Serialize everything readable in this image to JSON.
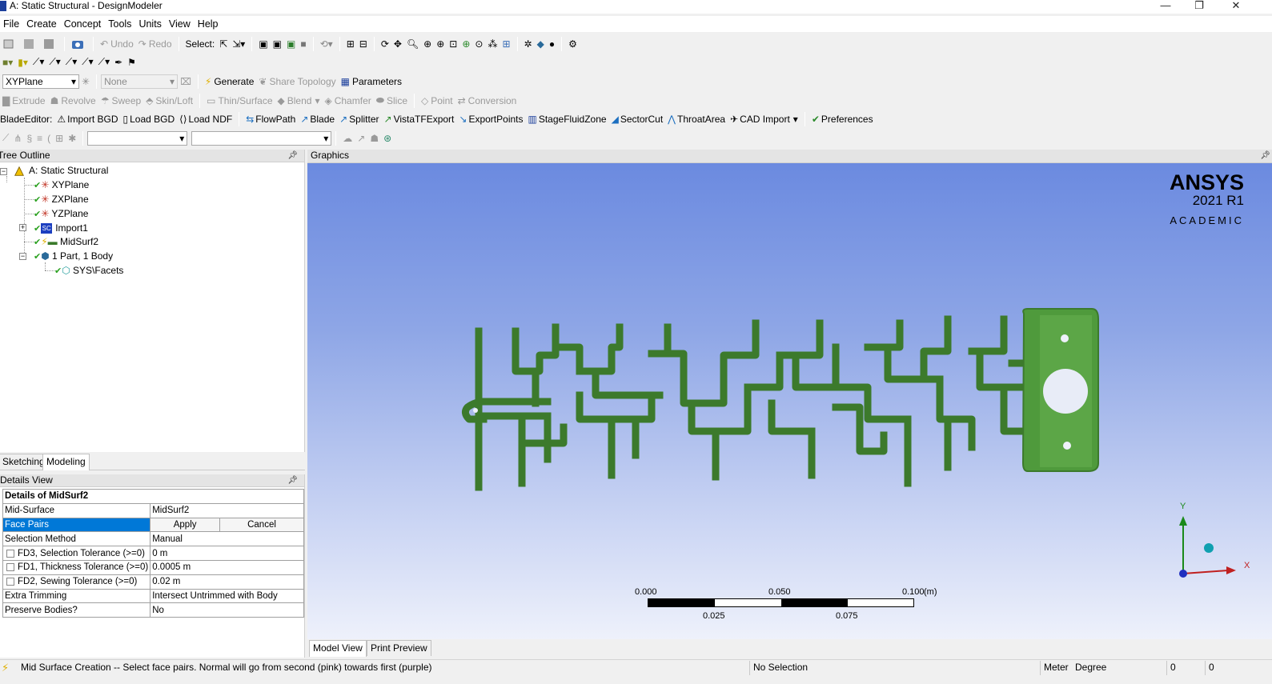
{
  "window": {
    "title": "A: Static Structural - DesignModeler",
    "minimize": "—",
    "restore": "❐",
    "close": "✕"
  },
  "menu": [
    "File",
    "Create",
    "Concept",
    "Tools",
    "Units",
    "View",
    "Help"
  ],
  "toolbar1": {
    "undo": "Undo",
    "redo": "Redo",
    "select_label": "Select:"
  },
  "toolbar3": {
    "plane_select": "XYPlane",
    "sketch_select": "None",
    "generate": "Generate",
    "share_topology": "Share Topology",
    "parameters": "Parameters"
  },
  "toolbar4": [
    "Extrude",
    "Revolve",
    "Sweep",
    "Skin/Loft",
    "Thin/Surface",
    "Blend",
    "Chamfer",
    "Slice",
    "Point",
    "Conversion"
  ],
  "toolbar5": {
    "label": "BladeEditor:",
    "items": [
      "Import BGD",
      "Load BGD",
      "Load NDF",
      "FlowPath",
      "Blade",
      "Splitter",
      "VistaTFExport",
      "ExportPoints",
      "StageFluidZone",
      "SectorCut",
      "ThroatArea",
      "CAD Import",
      "Preferences"
    ]
  },
  "tree": {
    "header": "Tree Outline",
    "root": "A: Static Structural",
    "nodes": [
      "XYPlane",
      "ZXPlane",
      "YZPlane",
      "Import1",
      "MidSurf2",
      "1 Part, 1 Body",
      "SYS\\Facets"
    ]
  },
  "panel_tabs": [
    "Sketching",
    "Modeling"
  ],
  "details": {
    "header": "Details View",
    "title": "Details of MidSurf2",
    "rows": [
      {
        "k": "Mid-Surface",
        "v": "MidSurf2"
      },
      {
        "k": "Face Pairs",
        "apply": "Apply",
        "cancel": "Cancel"
      },
      {
        "k": "Selection Method",
        "v": "Manual"
      },
      {
        "k": "FD3, Selection Tolerance (>=0)",
        "v": "0 m"
      },
      {
        "k": "FD1, Thickness Tolerance (>=0)",
        "v": "0.0005 m"
      },
      {
        "k": "FD2, Sewing Tolerance (>=0)",
        "v": "0.02 m"
      },
      {
        "k": "Extra Trimming",
        "v": "Intersect Untrimmed with Body"
      },
      {
        "k": "Preserve Bodies?",
        "v": "No"
      }
    ]
  },
  "graphics": {
    "header": "Graphics",
    "logo_brand": "ANSYS",
    "logo_version": "2021 R1",
    "logo_edition": "ACADEMIC",
    "scale_labels_top": [
      "0.000",
      "0.050",
      "0.100"
    ],
    "scale_unit": "(m)",
    "scale_labels_bottom": [
      "0.025",
      "0.075"
    ],
    "axis_y": "Y",
    "axis_x": "X",
    "model_color": "#4f9a3c",
    "tabs": [
      "Model View",
      "Print Preview"
    ]
  },
  "status": {
    "message": "Mid Surface Creation -- Select face pairs. Normal will go from second (pink) towards first (purple)",
    "selection": "No Selection",
    "units": "Meter",
    "angle": "Degree",
    "v1": "0",
    "v2": "0"
  }
}
